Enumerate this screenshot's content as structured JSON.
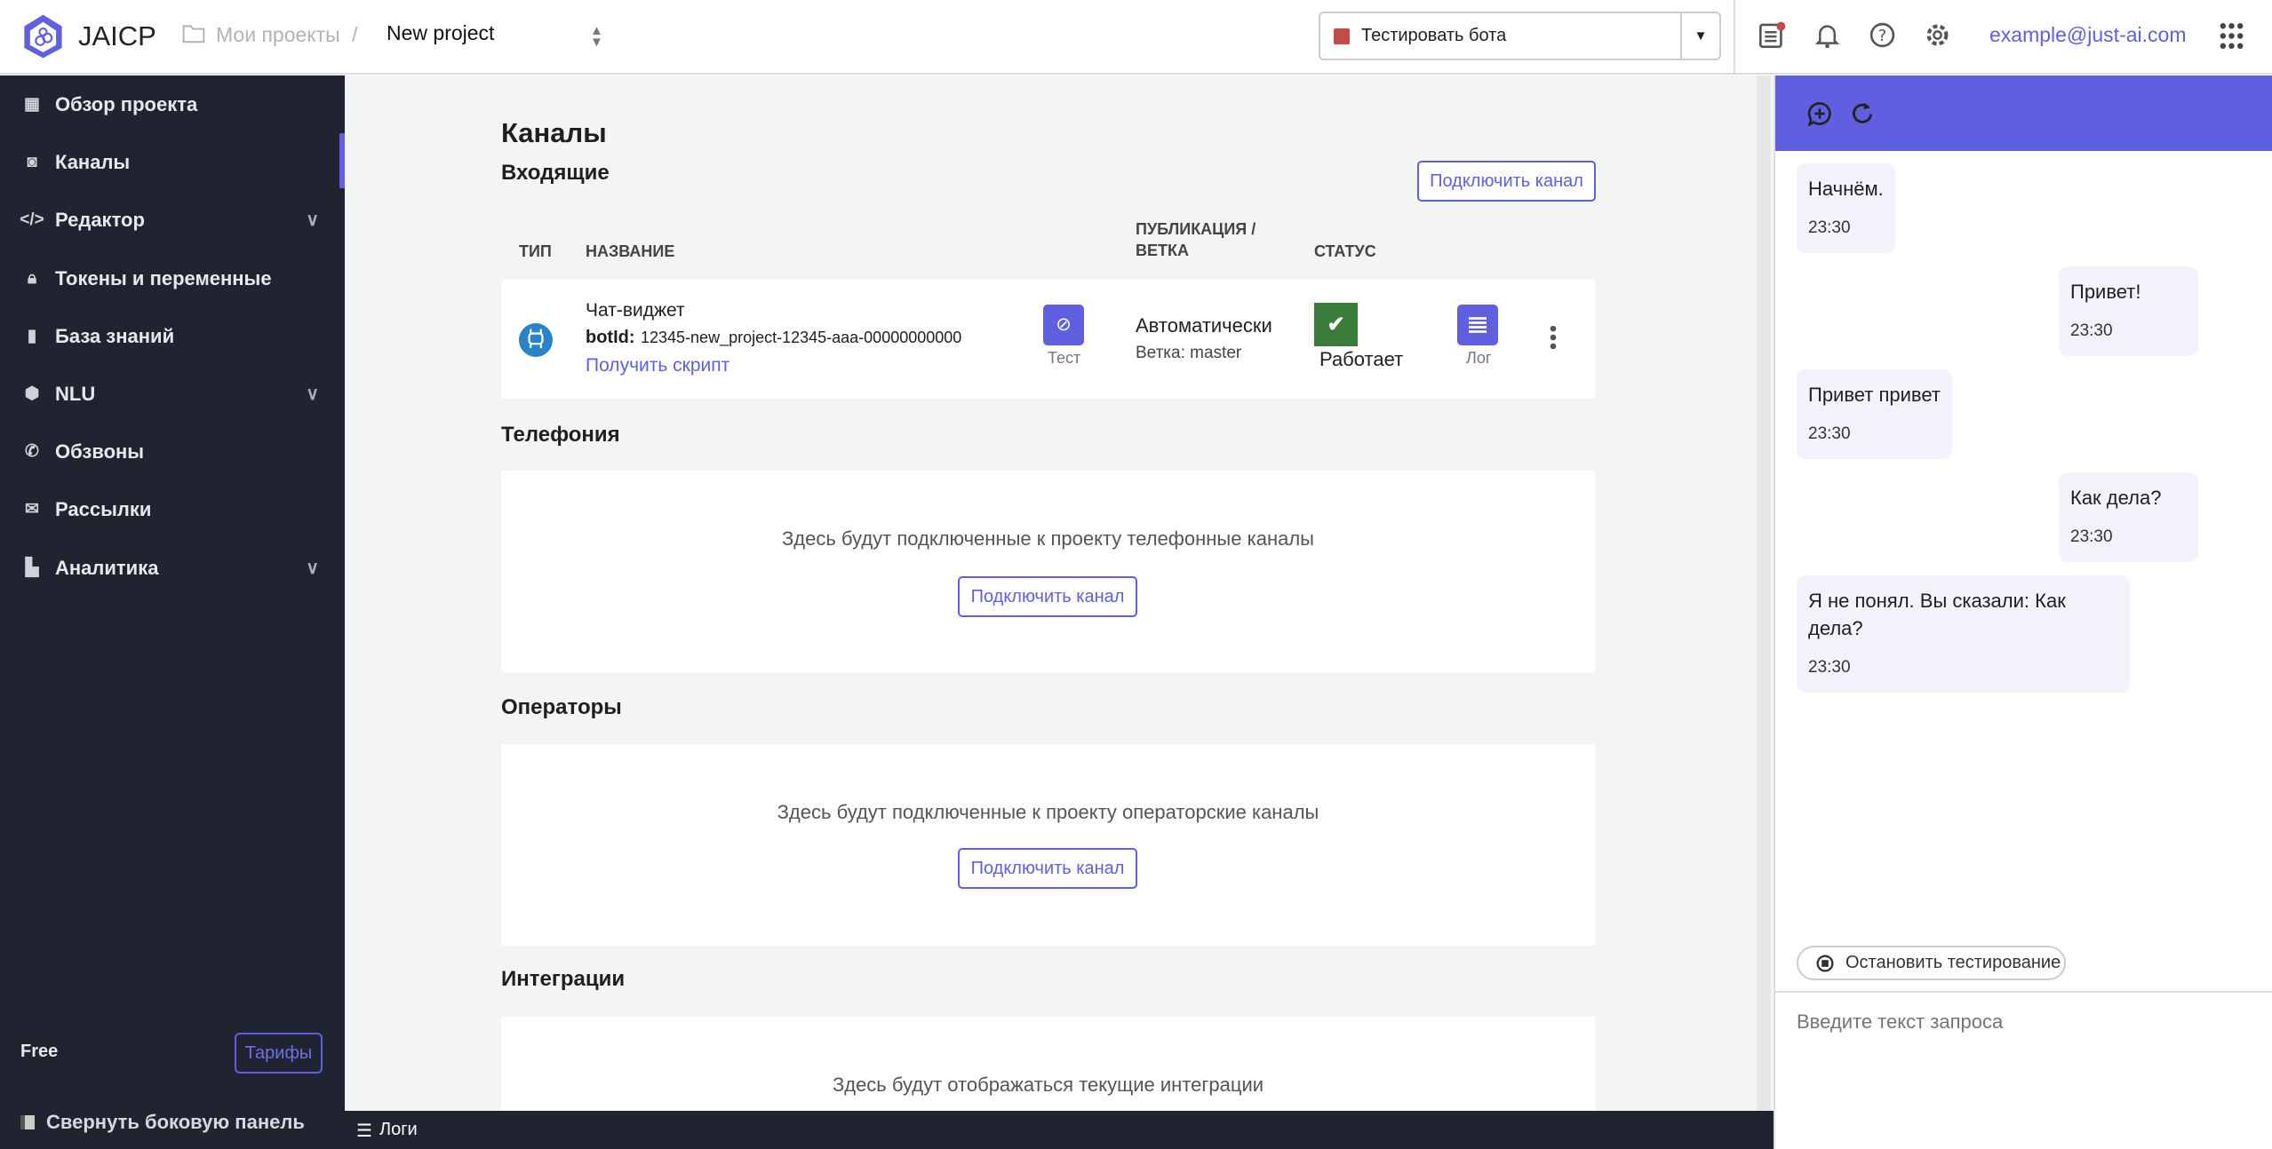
{
  "header": {
    "brand": "JAICP",
    "breadcrumb_root": "Мои проекты",
    "breadcrumb_sep": "/",
    "project": "New project",
    "test_bot_label": "Тестировать бота",
    "email": "example@just-ai.com"
  },
  "sidebar": {
    "items": [
      {
        "label": "Обзор проекта",
        "icon": "dashboard-icon"
      },
      {
        "label": "Каналы",
        "icon": "rss-icon",
        "active": true
      },
      {
        "label": "Редактор",
        "icon": "code-icon",
        "expandable": true
      },
      {
        "label": "Токены и переменные",
        "icon": "lock-icon"
      },
      {
        "label": "База знаний",
        "icon": "book-icon"
      },
      {
        "label": "NLU",
        "icon": "nlu-icon",
        "expandable": true
      },
      {
        "label": "Обзвоны",
        "icon": "phone-icon"
      },
      {
        "label": "Рассылки",
        "icon": "mail-icon"
      },
      {
        "label": "Аналитика",
        "icon": "chart-icon",
        "expandable": true
      }
    ],
    "plan": "Free",
    "tariffs_label": "Тарифы",
    "collapse_label": "Свернуть боковую панель"
  },
  "main": {
    "title": "Каналы",
    "incoming": {
      "title": "Входящие",
      "connect_label": "Подключить канал",
      "columns": {
        "type": "ТИП",
        "name": "НАЗВАНИЕ",
        "publication": "ПУБЛИКАЦИЯ /",
        "publication2": "ВЕТКА",
        "status": "СТАТУС"
      },
      "row": {
        "name": "Чат-виджет",
        "botid_label": "botId:",
        "botid": "12345-new_project-12345-aaa-00000000000",
        "script_link": "Получить скрипт",
        "test_label": "Тест",
        "publication": "Автоматически",
        "branch": "Ветка: master",
        "status": "Работает",
        "log_label": "Лог"
      }
    },
    "telephony": {
      "title": "Телефония",
      "empty": "Здесь будут подключенные к проекту телефонные каналы",
      "connect_label": "Подключить канал"
    },
    "operators": {
      "title": "Операторы",
      "empty": "Здесь будут подключенные к проекту операторские каналы",
      "connect_label": "Подключить канал"
    },
    "integrations": {
      "title": "Интеграции",
      "empty": "Здесь будут отображаться текущие интеграции"
    },
    "logs_label": "Логи"
  },
  "chat": {
    "messages": [
      {
        "from": "bot",
        "text": "Начнём.",
        "time": "23:30"
      },
      {
        "from": "user",
        "text": "Привет!",
        "time": "23:30"
      },
      {
        "from": "bot",
        "text": "Привет привет",
        "time": "23:30"
      },
      {
        "from": "user",
        "text": "Как дела?",
        "time": "23:30"
      },
      {
        "from": "bot",
        "text": "Я не понял. Вы сказали: Как дела?",
        "time": "23:30"
      }
    ],
    "stop_label": "Остановить тестирование",
    "input_placeholder": "Введите текст запроса"
  },
  "colors": {
    "accent": "#5f5fe0",
    "sidebar": "#1f2430",
    "status_ok": "#3a7d3a",
    "stop_red": "#c54a4a"
  }
}
